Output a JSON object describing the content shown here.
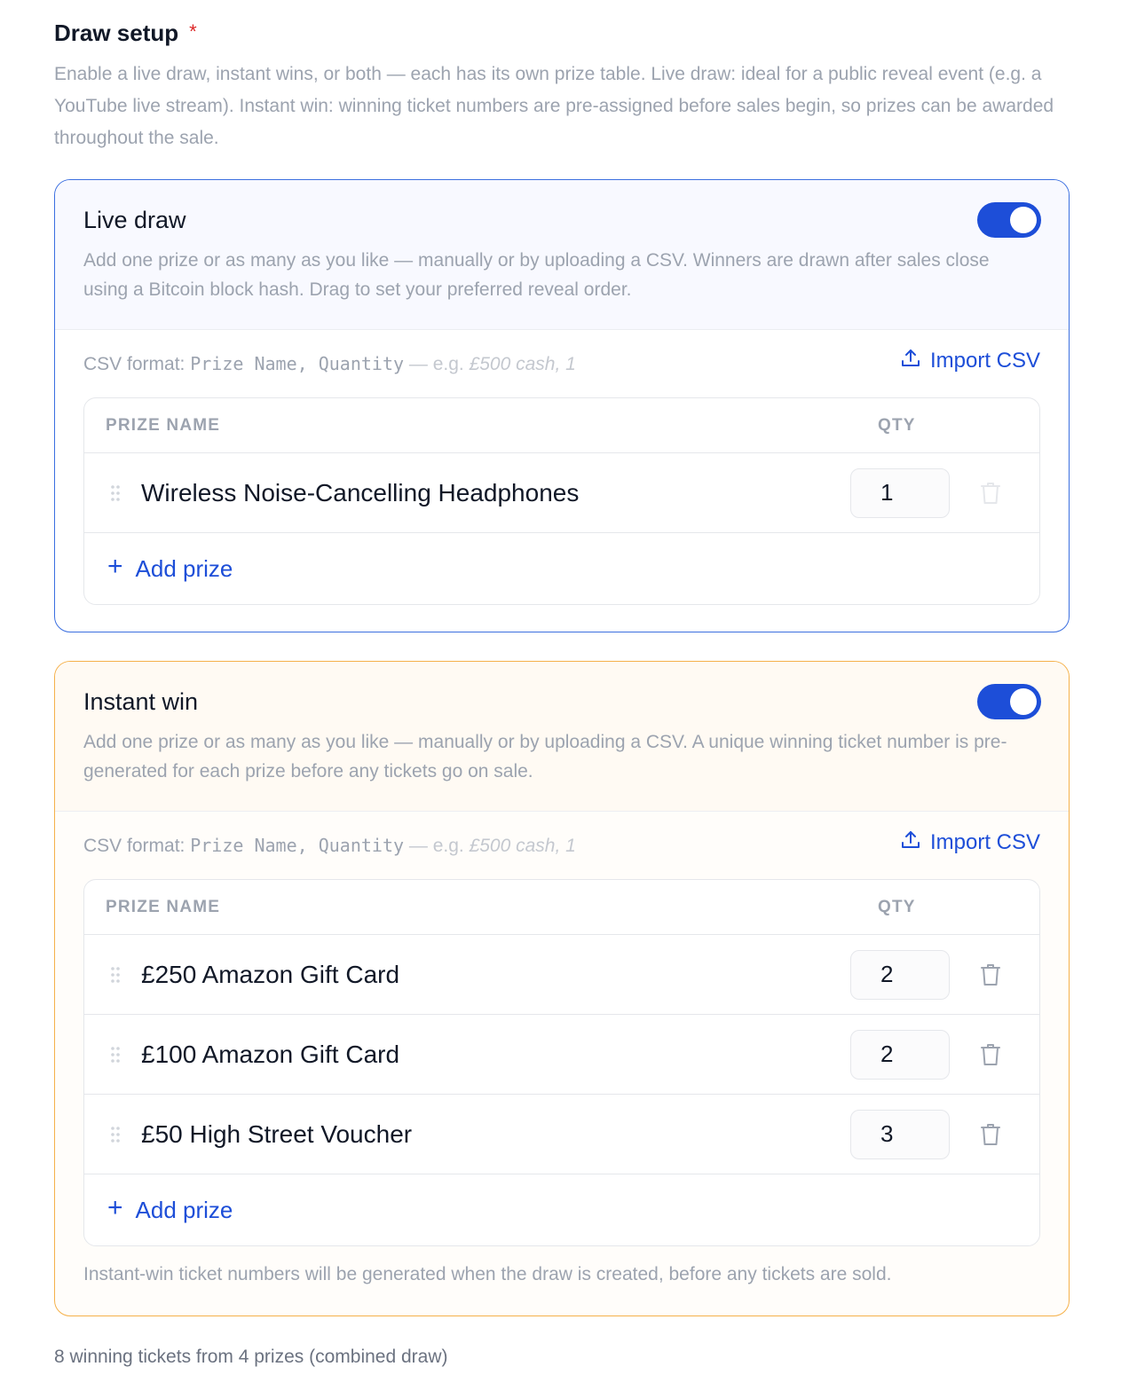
{
  "header": {
    "title": "Draw setup",
    "required_mark": "*",
    "description": "Enable a live draw, instant wins, or both — each has its own prize table. Live draw: ideal for a public reveal event (e.g. a YouTube live stream). Instant win: winning ticket numbers are pre-assigned before sales begin, so prizes can be awarded throughout the sale."
  },
  "colors": {
    "accent": "#1d4ed8",
    "live_border": "#3b6fe0",
    "instant_border": "#f5b14a"
  },
  "live": {
    "title": "Live draw",
    "enabled": true,
    "description": "Add one prize or as many as you like — manually or by uploading a CSV. Winners are drawn after sales close using a Bitcoin block hash. Drag to set your preferred reveal order.",
    "csv_prefix": "CSV format: ",
    "csv_format": "Prize Name, Quantity",
    "csv_eg": " — e.g. ",
    "csv_example": "£500 cash, 1",
    "import_label": "Import CSV",
    "col_name": "PRIZE NAME",
    "col_qty": "QTY",
    "prizes": [
      {
        "name": "Wireless Noise-Cancelling Headphones",
        "qty": "1"
      }
    ],
    "add_label": "Add prize"
  },
  "instant": {
    "title": "Instant win",
    "enabled": true,
    "description": "Add one prize or as many as you like — manually or by uploading a CSV. A unique winning ticket number is pre-generated for each prize before any tickets go on sale.",
    "csv_prefix": "CSV format: ",
    "csv_format": "Prize Name, Quantity",
    "csv_eg": " — e.g. ",
    "csv_example": "£500 cash, 1",
    "import_label": "Import CSV",
    "col_name": "PRIZE NAME",
    "col_qty": "QTY",
    "prizes": [
      {
        "name": "£250 Amazon Gift Card",
        "qty": "2"
      },
      {
        "name": "£100 Amazon Gift Card",
        "qty": "2"
      },
      {
        "name": "£50 High Street Voucher",
        "qty": "3"
      }
    ],
    "add_label": "Add prize",
    "footnote": "Instant-win ticket numbers will be generated when the draw is created, before any tickets are sold."
  },
  "summary": "8 winning tickets from 4 prizes (combined draw)"
}
